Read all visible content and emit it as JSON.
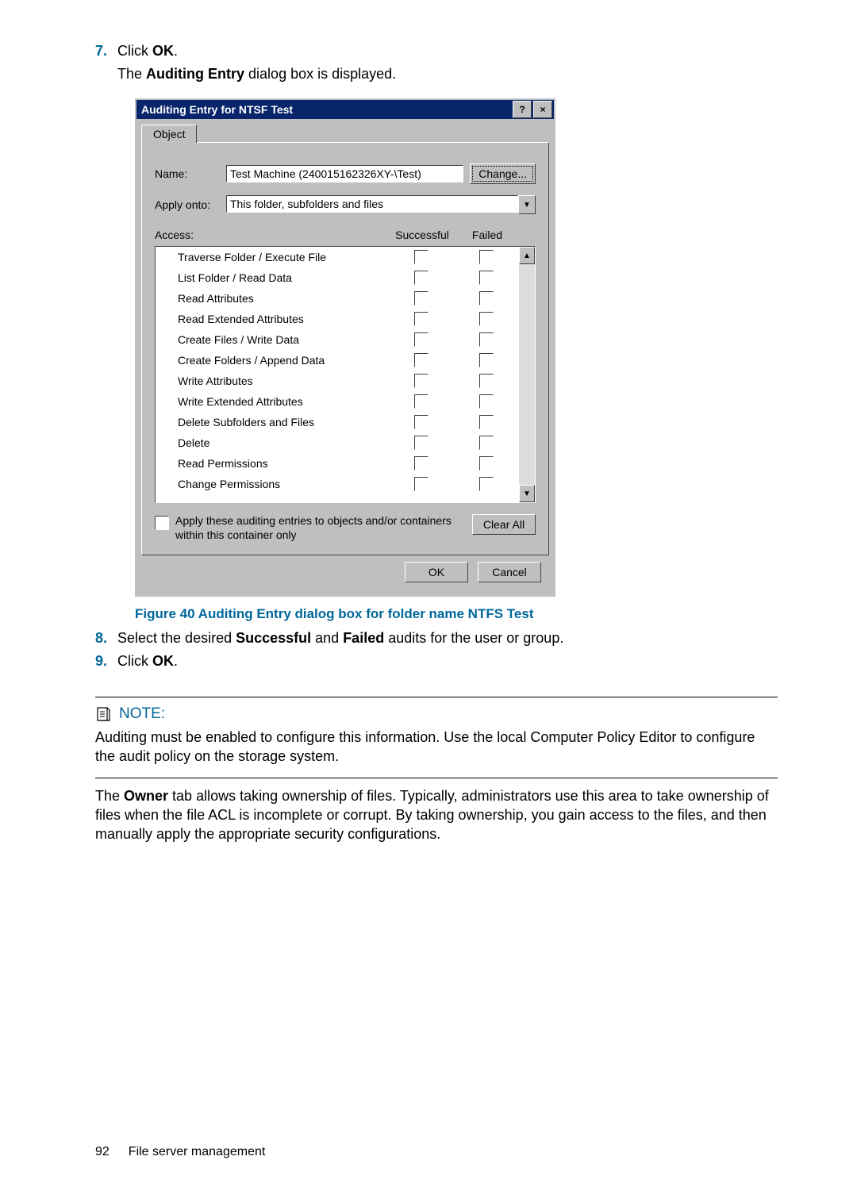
{
  "steps": {
    "s7": {
      "num": "7.",
      "prefix": "Click ",
      "bold": "OK",
      "suffix": "."
    },
    "s7b": {
      "prefix": "The ",
      "bold": "Auditing Entry",
      "suffix": " dialog box is displayed."
    },
    "s8": {
      "num": "8.",
      "prefix": "Select the desired ",
      "bold1": "Successful",
      "mid": " and ",
      "bold2": "Failed",
      "suffix": " audits for the user or group."
    },
    "s9": {
      "num": "9.",
      "prefix": "Click ",
      "bold": "OK",
      "suffix": "."
    }
  },
  "dialog": {
    "title": "Auditing Entry for NTSF Test",
    "help_glyph": "?",
    "close_glyph": "×",
    "tab_label": "Object",
    "name_label": "Name:",
    "name_value": "Test Machine (240015162326XY-\\Test)",
    "change_label": "Change...",
    "apply_onto_label": "Apply onto:",
    "apply_onto_value": "This folder, subfolders and files",
    "access_label": "Access:",
    "col_success": "Successful",
    "col_failed": "Failed",
    "permissions": [
      "Traverse Folder / Execute File",
      "List Folder / Read Data",
      "Read Attributes",
      "Read Extended Attributes",
      "Create Files / Write Data",
      "Create Folders / Append Data",
      "Write Attributes",
      "Write Extended Attributes",
      "Delete Subfolders and Files",
      "Delete",
      "Read Permissions",
      "Change Permissions"
    ],
    "apply_recursive": "Apply these auditing entries to objects and/or containers within this container only",
    "clear_all": "Clear All",
    "ok": "OK",
    "cancel": "Cancel",
    "dd_glyph": "▼",
    "sb_up": "▲",
    "sb_dn": "▼"
  },
  "figure_caption": "Figure 40 Auditing Entry dialog box for folder name NTFS Test",
  "note": {
    "heading": "NOTE:",
    "body": "Auditing must be enabled to configure this information. Use the local Computer Policy Editor to configure the audit policy on the storage system."
  },
  "owner_para": {
    "prefix": "The ",
    "bold": "Owner",
    "suffix": " tab allows taking ownership of files. Typically, administrators use this area to take ownership of files when the file ACL is incomplete or corrupt. By taking ownership, you gain access to the files, and then manually apply the appropriate security configurations."
  },
  "footer": {
    "page": "92",
    "title": "File server management"
  }
}
